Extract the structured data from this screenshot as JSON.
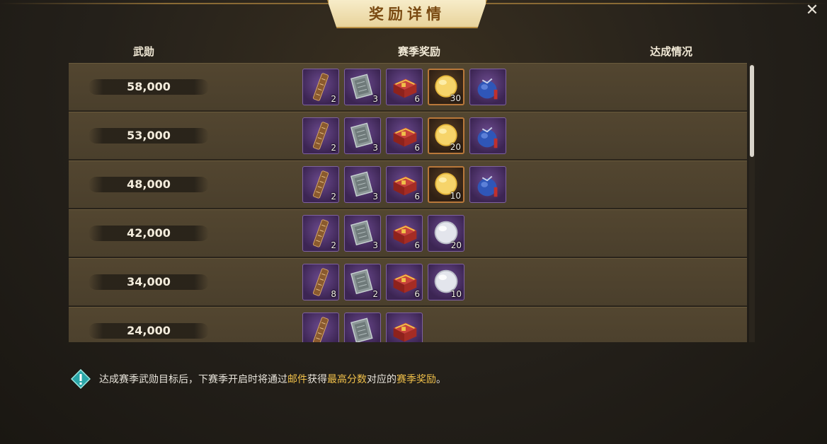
{
  "title": "奖励详情",
  "close_label": "✕",
  "columns": {
    "score": "武勋",
    "rewards": "赛季奖励",
    "status": "达成情况"
  },
  "rows": [
    {
      "score": "58,000",
      "items": [
        {
          "icon": "scroll-icon",
          "rarity": "purple",
          "qty": "2"
        },
        {
          "icon": "book-icon",
          "rarity": "purple",
          "qty": "3"
        },
        {
          "icon": "chest-icon",
          "rarity": "purple",
          "qty": "6"
        },
        {
          "icon": "gold-coin-icon",
          "rarity": "orange",
          "qty": "30"
        },
        {
          "icon": "pouch-icon",
          "rarity": "purple",
          "qty": ""
        }
      ]
    },
    {
      "score": "53,000",
      "items": [
        {
          "icon": "scroll-icon",
          "rarity": "purple",
          "qty": "2"
        },
        {
          "icon": "book-icon",
          "rarity": "purple",
          "qty": "3"
        },
        {
          "icon": "chest-icon",
          "rarity": "purple",
          "qty": "6"
        },
        {
          "icon": "gold-coin-icon",
          "rarity": "orange",
          "qty": "20"
        },
        {
          "icon": "pouch-icon",
          "rarity": "purple",
          "qty": ""
        }
      ]
    },
    {
      "score": "48,000",
      "items": [
        {
          "icon": "scroll-icon",
          "rarity": "purple",
          "qty": "2"
        },
        {
          "icon": "book-icon",
          "rarity": "purple",
          "qty": "3"
        },
        {
          "icon": "chest-icon",
          "rarity": "purple",
          "qty": "6"
        },
        {
          "icon": "gold-coin-icon",
          "rarity": "orange",
          "qty": "10"
        },
        {
          "icon": "pouch-icon",
          "rarity": "purple",
          "qty": ""
        }
      ]
    },
    {
      "score": "42,000",
      "items": [
        {
          "icon": "scroll-icon",
          "rarity": "purple",
          "qty": "2"
        },
        {
          "icon": "book-icon",
          "rarity": "purple",
          "qty": "3"
        },
        {
          "icon": "chest-icon",
          "rarity": "purple",
          "qty": "6"
        },
        {
          "icon": "silver-coin-icon",
          "rarity": "purple",
          "qty": "20"
        }
      ]
    },
    {
      "score": "34,000",
      "items": [
        {
          "icon": "scroll-icon",
          "rarity": "purple",
          "qty": "8"
        },
        {
          "icon": "book-icon",
          "rarity": "purple",
          "qty": "2"
        },
        {
          "icon": "chest-icon",
          "rarity": "purple",
          "qty": "6"
        },
        {
          "icon": "silver-coin-icon",
          "rarity": "purple",
          "qty": "10"
        }
      ]
    },
    {
      "score": "24,000",
      "items": [
        {
          "icon": "scroll-icon",
          "rarity": "purple",
          "qty": ""
        },
        {
          "icon": "book-icon",
          "rarity": "purple",
          "qty": ""
        },
        {
          "icon": "chest-icon",
          "rarity": "purple",
          "qty": ""
        }
      ]
    }
  ],
  "hint": {
    "icon": "info-diamond-icon",
    "parts": [
      {
        "text": "达成赛季武勋目标后，下赛季开启时将通过",
        "hl": false
      },
      {
        "text": "邮件",
        "hl": true
      },
      {
        "text": "获得",
        "hl": false
      },
      {
        "text": "最高分数",
        "hl": true
      },
      {
        "text": "对应的",
        "hl": false
      },
      {
        "text": "赛季奖励",
        "hl": true
      },
      {
        "text": "。",
        "hl": false
      }
    ]
  },
  "colors": {
    "highlight": "#f0c04a",
    "purple_frame": "#7e62a0",
    "orange_frame": "#b9783a"
  }
}
